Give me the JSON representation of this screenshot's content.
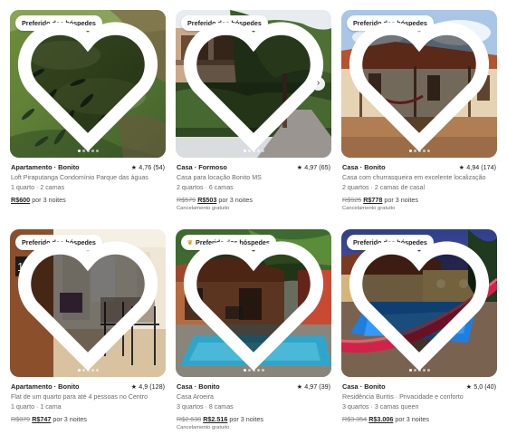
{
  "listings": [
    {
      "badge": "Preferido dos hóspedes",
      "type": "Apartamento · Bonito",
      "rating": "4,76 (54)",
      "title": "Loft Piraputanga Condomínio Parque das águas",
      "details": "1 quarto · 2 camas",
      "old_price": "",
      "price": "R$600",
      "per": "por 3 noites",
      "cancel": ""
    },
    {
      "badge": "Preferido dos hóspedes",
      "type": "Casa · Formoso",
      "rating": "4,97 (65)",
      "title": "Casa para locação Bonito MS",
      "details": "2 quartos · 6 camas",
      "old_price": "R$579",
      "price": "R$503",
      "per": "por 3 noites",
      "cancel": "Cancelamento gratuito"
    },
    {
      "badge": "Preferido dos hóspedes",
      "type": "Casa · Bonito",
      "rating": "4,94 (174)",
      "title": "Casa com churrasqueira em excelente localização",
      "details": "2 quartos · 2 camas de casal",
      "old_price": "R$925",
      "price": "R$778",
      "per": "por 3 noites",
      "cancel": "Cancelamento gratuito"
    },
    {
      "badge": "Preferido dos hóspedes",
      "type": "Apartamento · Bonito",
      "rating": "4,9 (128)",
      "title": "Flat de um quarto para até 4 pessoas no Centro",
      "details": "1 quarto · 1 cama",
      "old_price": "R$879",
      "price": "R$747",
      "per": "por 3 noites",
      "cancel": ""
    },
    {
      "badge": "Preferido dos hóspedes",
      "type": "Casa · Bonito",
      "rating": "4,97 (39)",
      "title": "Casa Aroeira",
      "details": "3 quartos · 8 camas",
      "old_price": "R$2.638",
      "price": "R$2.516",
      "per": "por 3 noites",
      "cancel": "Cancelamento gratuito"
    },
    {
      "badge": "Preferido dos hóspedes",
      "type": "Casa · Bonito",
      "rating": "5,0 (40)",
      "title": "Residência Buritis · Privacidade e conforto",
      "details": "3 quartos · 3 camas queen",
      "old_price": "R$3.354",
      "price": "R$3.006",
      "per": "por 3 noites",
      "cancel": ""
    }
  ],
  "icons": {
    "favorite": "heart-icon",
    "rating": "star-icon",
    "next": "chevron-right-icon",
    "badge_special": "laurel-icon"
  },
  "colors": {
    "text": "#222222",
    "muted": "#6a6a6a",
    "strike": "#8a8a8a",
    "badge_bg": "#ffffff"
  }
}
